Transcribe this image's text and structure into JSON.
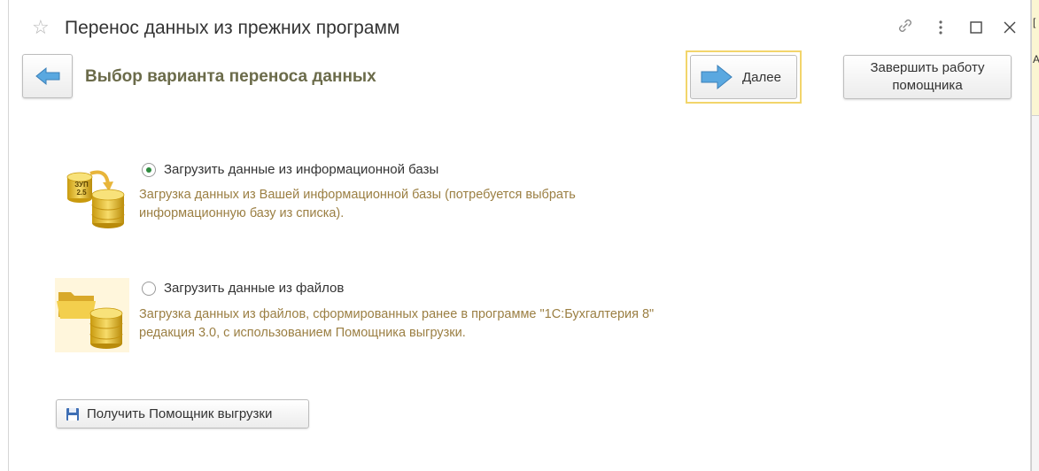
{
  "window": {
    "title": "Перенос данных из прежних программ",
    "title_icons": [
      "star-icon",
      "link-icon",
      "more-icon",
      "maximize-icon",
      "close-icon"
    ]
  },
  "toolbar": {
    "subtitle": "Выбор варианта переноса данных",
    "next_label": "Далее",
    "finish_label_line1": "Завершить работу",
    "finish_label_line2": "помощника"
  },
  "options": [
    {
      "label": "Загрузить данные из информационной базы",
      "selected": true,
      "icon_badge_line1": "ЗУП",
      "icon_badge_line2": "2.5",
      "description_line1": "Загрузка данных из Вашей информационной базы (потребуется выбрать",
      "description_line2": "информационную базу из списка)."
    },
    {
      "label": "Загрузить данные из файлов",
      "selected": false,
      "description_line1": "Загрузка данных из файлов, сформированных ранее в программе \"1С:Бухгалтерия 8\"",
      "description_line2": "редакция 3.0, с использованием Помощника выгрузки."
    }
  ],
  "get_assistant_label": "Получить Помощник выгрузки",
  "colors": {
    "subtitle": "#6b6b4a",
    "description": "#9b7f43",
    "default_button_border": "#f2d56b",
    "radio_selected": "#2e8a3e",
    "arrow": "#4e9fd9"
  }
}
